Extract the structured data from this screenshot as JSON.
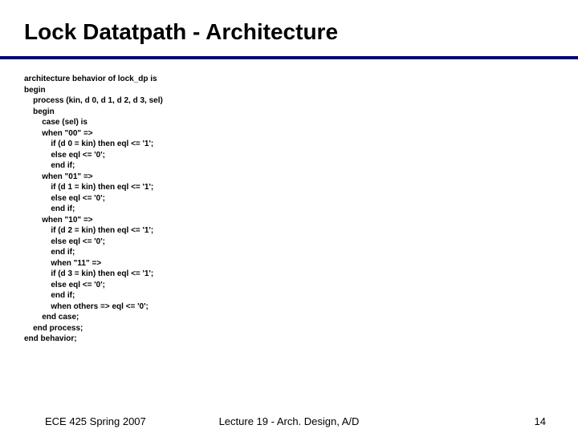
{
  "title": "Lock Datatpath - Architecture",
  "code": "architecture behavior of lock_dp is\nbegin\n    process (kin, d 0, d 1, d 2, d 3, sel)\n    begin\n        case (sel) is\n        when \"00\" =>\n            if (d 0 = kin) then eql <= '1';\n            else eql <= '0';\n            end if;\n        when \"01\" =>\n            if (d 1 = kin) then eql <= '1';\n            else eql <= '0';\n            end if;\n        when \"10\" =>\n            if (d 2 = kin) then eql <= '1';\n            else eql <= '0';\n            end if;\n            when \"11\" =>\n            if (d 3 = kin) then eql <= '1';\n            else eql <= '0';\n            end if;\n            when others => eql <= '0';\n        end case;\n    end process;\nend behavior;",
  "footer": {
    "left": "ECE 425 Spring 2007",
    "center": "Lecture 19 - Arch. Design, A/D",
    "right": "14"
  }
}
